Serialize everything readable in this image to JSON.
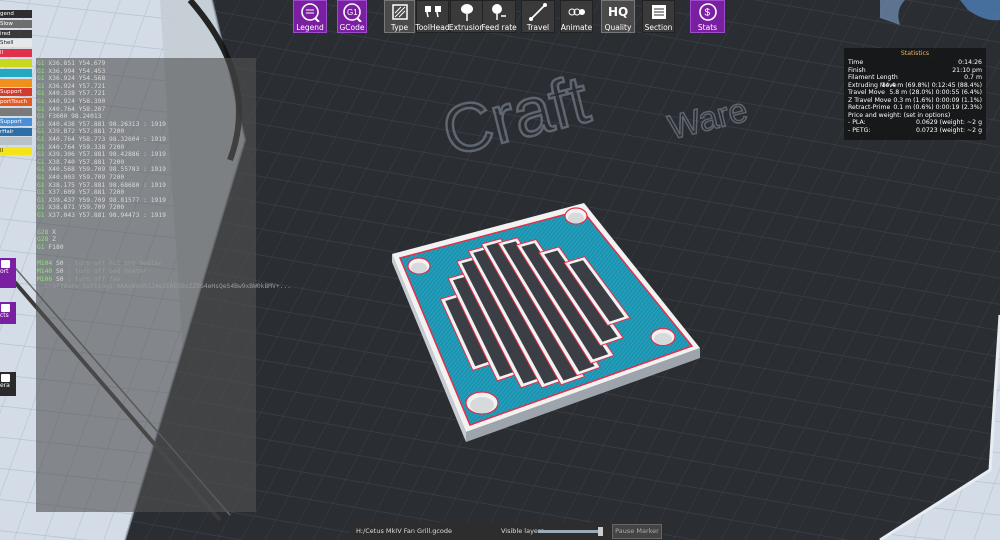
{
  "toolbar": {
    "buttons": [
      {
        "label": "Legend",
        "icon": "legend-icon"
      },
      {
        "label": "GCode",
        "icon": "gcode-icon"
      },
      {
        "label": "Type",
        "icon": "type-icon"
      },
      {
        "label": "ToolHead",
        "icon": "toolhead-icon"
      },
      {
        "label": "Extrusion",
        "icon": "extrusion-icon"
      },
      {
        "label": "Feed rate",
        "icon": "feedrate-icon"
      },
      {
        "label": "Travel",
        "icon": "travel-icon"
      },
      {
        "label": "Animate",
        "icon": "animate-icon"
      },
      {
        "label": "Quality",
        "icon": "quality-icon",
        "badge": "HQ"
      },
      {
        "label": "Section",
        "icon": "section-icon"
      },
      {
        "label": "Stats",
        "icon": "stats-icon"
      }
    ]
  },
  "watermark": {
    "logo_main": "Craft",
    "logo_sub": "Ware"
  },
  "gcode_panel": {
    "lines": [
      {
        "code": "G1",
        "text": " X36.851 Y54.679"
      },
      {
        "code": "G1",
        "text": " X36.994 Y54.453"
      },
      {
        "code": "G1",
        "text": " X36.924 Y54.568"
      },
      {
        "code": "G1",
        "text": " X36.924 Y57.721"
      },
      {
        "code": "G1",
        "text": " X40.338 Y57.721"
      },
      {
        "code": "G1",
        "text": " X40.924 Y58.390"
      },
      {
        "code": "G1",
        "text": " X40.764 Y58.207"
      },
      {
        "code": "G1",
        "text": " F3600   98.24013"
      },
      {
        "code": "G1",
        "text": " X40.438 Y57.881  98.26313 : 1919"
      },
      {
        "code": "G1",
        "text": " X39.872 Y57.881  7200"
      },
      {
        "code": "G1",
        "text": " X40.764 Y58.773  98.32604 : 1919"
      },
      {
        "code": "G1",
        "text": " X40.764 Y59.338  7200"
      },
      {
        "code": "G1",
        "text": " X39.306 Y57.881  98.42886 : 1919"
      },
      {
        "code": "G1",
        "text": " X38.740 Y57.881  7200"
      },
      {
        "code": "G1",
        "text": " X40.568 Y59.709  98.55783 : 1919"
      },
      {
        "code": "G1",
        "text": " X40.003 Y59.709  7200"
      },
      {
        "code": "G1",
        "text": " X38.175 Y57.881  98.68680 : 1919"
      },
      {
        "code": "G1",
        "text": " X37.609 Y57.881  7200"
      },
      {
        "code": "G1",
        "text": " X39.437 Y59.709  98.81577 : 1919"
      },
      {
        "code": "G1",
        "text": " X38.871 Y59.709  7200"
      },
      {
        "code": "G1",
        "text": " X37.043 Y57.881  98.94473 : 1919"
      }
    ],
    "lines2": [
      {
        "code": "G28",
        "text": " X"
      },
      {
        "code": "G28",
        "text": " Z"
      },
      {
        "code": "G1",
        "text": " F180"
      }
    ],
    "lines3": [
      {
        "code": "M104",
        "text": " S0",
        "comment": " ; turn off hot end heater"
      },
      {
        "code": "M140",
        "text": " S0",
        "comment": " ; turn off bed heater"
      },
      {
        "code": "M106",
        "text": " S0",
        "comment": " ; turn off fan"
      },
      {
        "code": "",
        "text": "",
        "comment": "; CraftWare_Settings:AAAgWAoRJJ4eIEAB5OzZZXG4eHsQeS4Bw9xBW0kBMV+..."
      }
    ]
  },
  "left_strip": {
    "legend_items": [
      {
        "label": "gend",
        "color": "#2e2e2e"
      },
      {
        "label": "Slow",
        "color": "#6e6e6e"
      },
      {
        "label": "ired",
        "color": "#3a3a3a"
      },
      {
        "label": "Shell",
        "color": "#e8e8e8"
      },
      {
        "label": "ll",
        "color": "#e0304a"
      },
      {
        "label": "",
        "color": "#c9d81e"
      },
      {
        "label": "",
        "color": "#24a7c0"
      },
      {
        "label": "",
        "color": "#f0901c"
      },
      {
        "label": "Support",
        "color": "#d33b2a"
      },
      {
        "label": "portTouch",
        "color": "#e55a1f"
      },
      {
        "label": "",
        "color": "#7a7a7a"
      },
      {
        "label": "Support",
        "color": "#4a8ed6"
      },
      {
        "label": "rHair",
        "color": "#2c6fa8"
      },
      {
        "label": "",
        "color": "#b8c0c8"
      },
      {
        "label": "Il",
        "color": "#f4e418"
      }
    ],
    "side_buttons": [
      {
        "label": "ort",
        "icon": "import-icon"
      },
      {
        "label": "cts",
        "icon": "objects-icon"
      },
      {
        "label": "era",
        "icon": "camera-icon"
      }
    ]
  },
  "statistics": {
    "title": "Statistics",
    "rows": [
      {
        "key": "Time",
        "value": "0:14:26"
      },
      {
        "key": "Finish",
        "value": "21:10 pm"
      },
      {
        "key": "Filament Length",
        "value": "0.7 m"
      },
      {
        "key": "Extruding Move",
        "value": "14.4 m (69.8%) 0:12:45 (88.4%)"
      },
      {
        "key": "Travel Move",
        "value": "5.8 m (28.0%) 0:00:55 (6.4%)"
      },
      {
        "key": "Z Travel Move",
        "value": "0.3 m (1.6%) 0:00:09 (1.1%)"
      },
      {
        "key": "Retract-Prime",
        "value": "0.1 m (0.6%) 0:00:19 (2.3%)"
      },
      {
        "key": "Price and weight: (set in options)",
        "value": ""
      },
      {
        "key": " - PLA:",
        "value": "0.0629 (weight: ~2 g"
      },
      {
        "key": " - PETG:",
        "value": "0.0723 (weight: ~2 g"
      }
    ]
  },
  "bottom_bar": {
    "file_path": "H:/Cetus MkIV Fan Grill.gcode",
    "visible_layers_label": "Visible layers",
    "visible_layers_value": 1.0,
    "pause_marker_label": "Pause Marker"
  },
  "colors": {
    "toolbar_purple": "#7b1fa2",
    "toolbar_dark": "#3a3a3a",
    "bed_dark": "#2b2e33",
    "print_blue": "#1f9bb6",
    "print_red": "#e0304a",
    "print_white": "#f0f0f0"
  }
}
